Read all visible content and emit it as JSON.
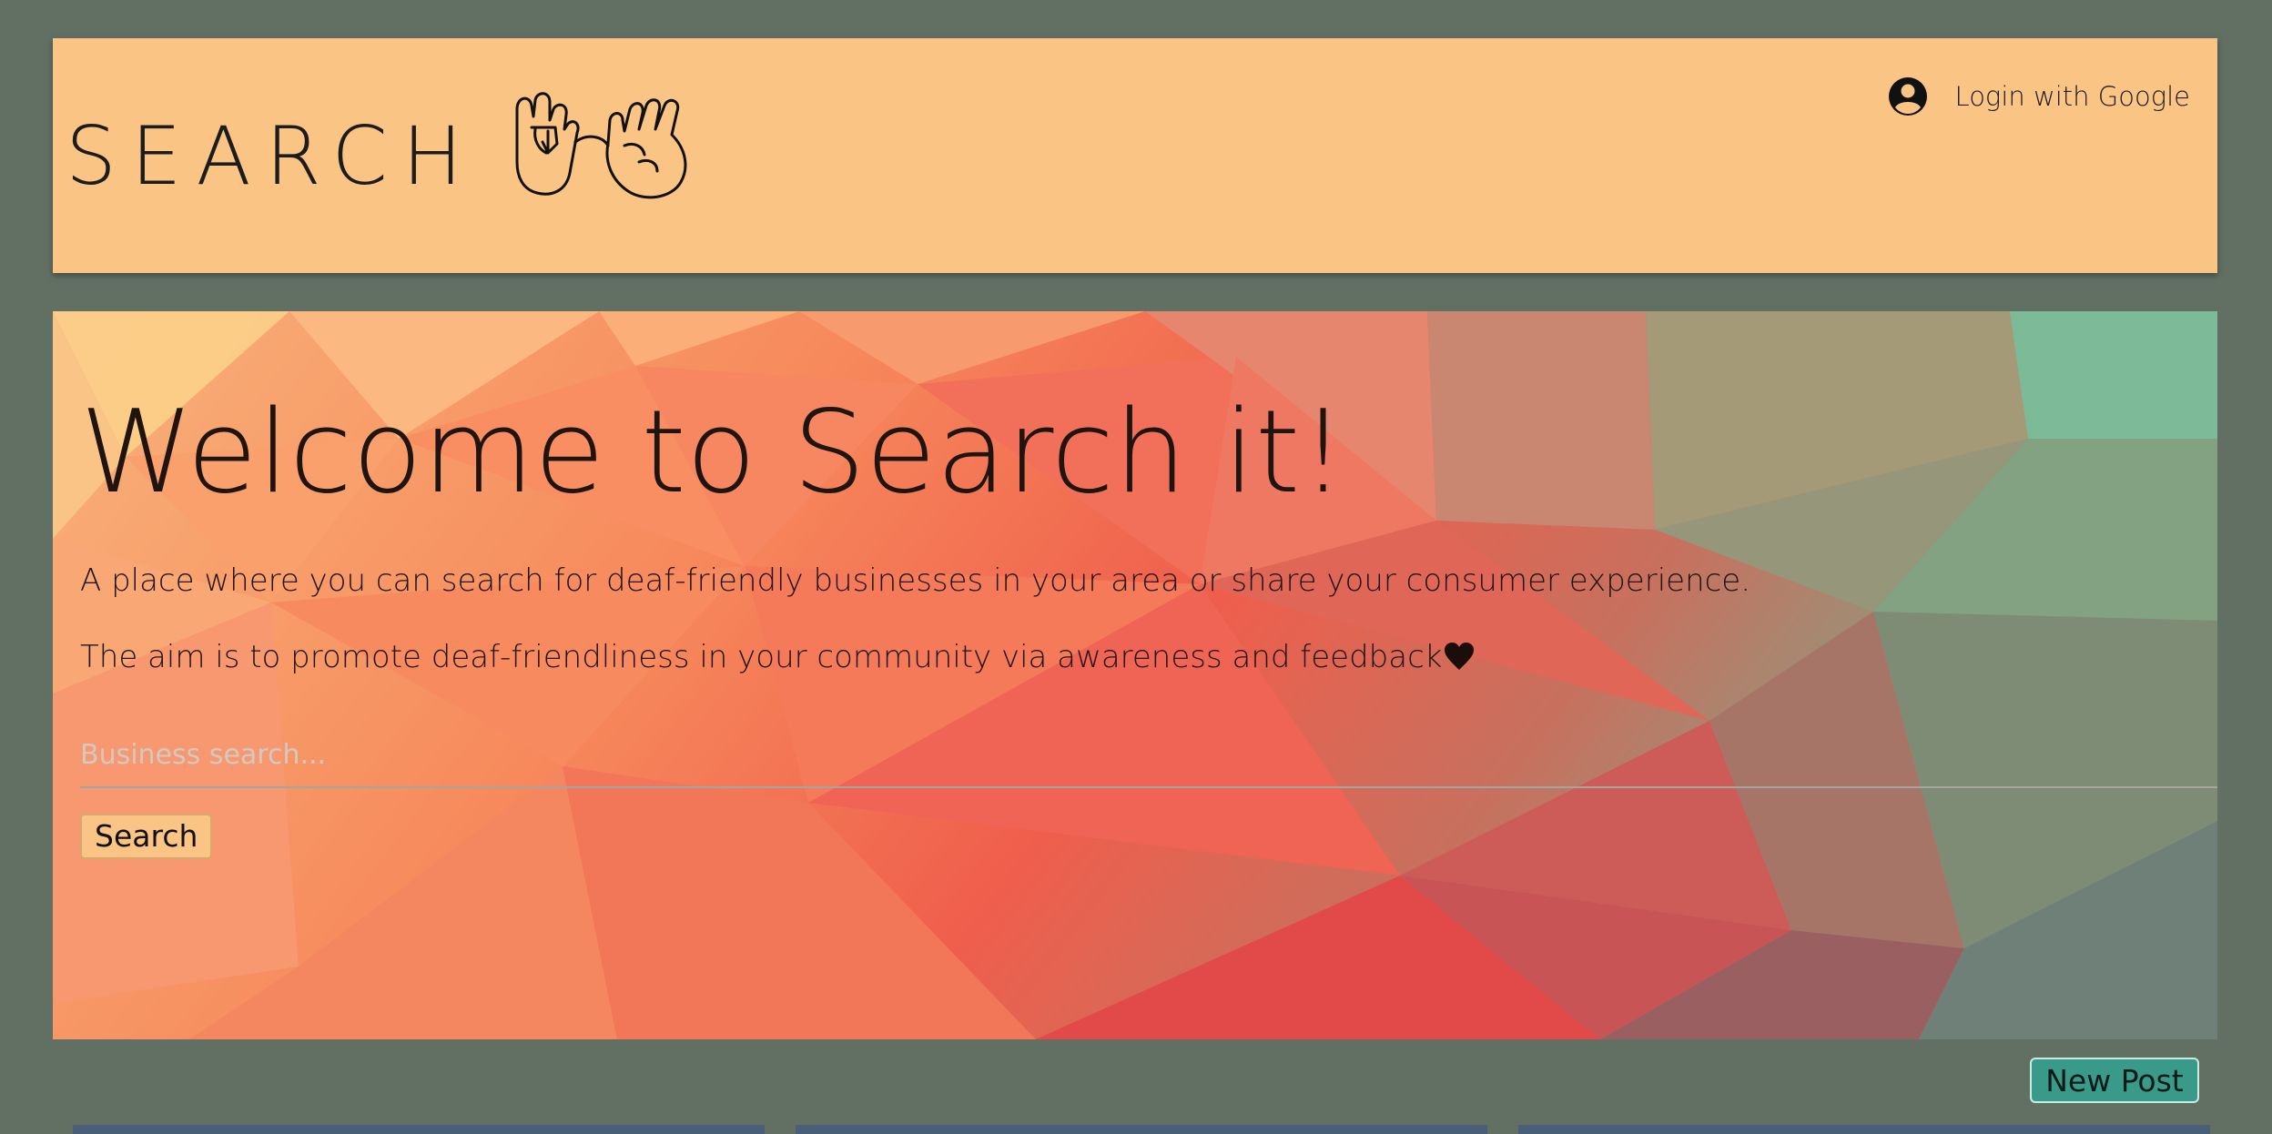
{
  "header": {
    "logo_text": "SEARCH",
    "login_label": "Login with Google",
    "login_icon": "account-circle-icon",
    "background": "#fac485"
  },
  "hero": {
    "title": "Welcome to Search it!",
    "paragraph_1": "A place where you can search for deaf-friendly businesses in your area or share your consumer experience.",
    "paragraph_2": "The aim is to promote deaf-friendliness in your community via awareness and feedback",
    "heart_icon": "heart-icon",
    "search_placeholder": "Business search...",
    "search_button": "Search"
  },
  "actions": {
    "new_post": "New Post"
  },
  "colors": {
    "page_background": "#626f63",
    "new_post_button": "#3a9a8a"
  }
}
